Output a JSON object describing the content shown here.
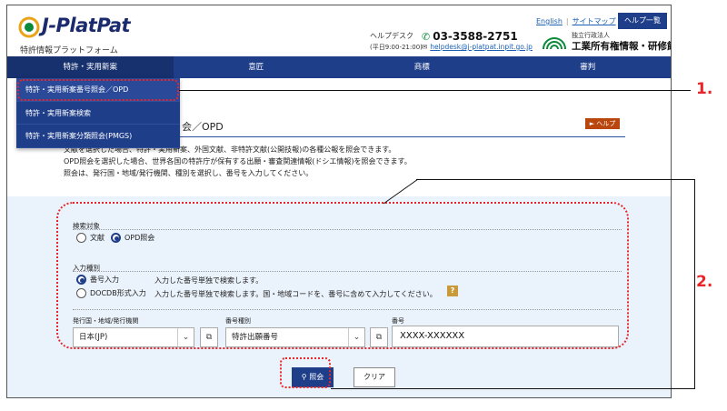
{
  "header": {
    "logo_text": "J-PlatPat",
    "logo_sub": "特許情報プラットフォーム",
    "helpdesk_label": "ヘルプデスク",
    "helpdesk_hours": "(平日9:00-21:00)",
    "phone": "03-3588-2751",
    "email": "helpdesk@j-platpat.inpit.go.jp",
    "links": {
      "english": "English",
      "sitemap": "サイトマップ"
    },
    "help_list": "ヘルプ一覧",
    "org_sub": "独立行政法人",
    "org_name": "工業所有権情報・研修館",
    "org_mark_text": "INPIT"
  },
  "nav": {
    "items": [
      "特許・実用新案",
      "意匠",
      "商標",
      "審判"
    ]
  },
  "dropdown": {
    "items": [
      "特許・実用新案番号照会／OPD",
      "特許・実用新案検索",
      "特許・実用新案分類照会(PMGS)"
    ]
  },
  "page": {
    "title": "会／OPD",
    "help": "► ヘルプ",
    "desc": [
      "文献を選択した場合、特許・実用新案、外国文献、非特許文献(公開技報)の各種公報を照会できます。",
      "OPD照会を選択した場合、世界各国の特許庁が保有する出願・審査関連情報(ドシエ情報)を照会できます。",
      "照会は、発行国・地域/発行機関、種別を選択し、番号を入力してください。"
    ]
  },
  "form": {
    "search_target_label": "検索対象",
    "target_options": [
      "文献",
      "OPD照会"
    ],
    "selected_target": "OPD照会",
    "input_type_label": "入力種別",
    "input_options": [
      {
        "label": "番号入力",
        "hint": "入力した番号単独で検索します。"
      },
      {
        "label": "DOCDB形式入力",
        "hint": "入力した番号単独で検索します。国・地域コードを、番号に含めて入力してください。"
      }
    ],
    "question_mark": "?",
    "country_label": "発行国・地域/発行機関",
    "country_value": "日本(JP)",
    "type_label": "番号種別",
    "type_value": "特許出願番号",
    "number_label": "番号",
    "number_value": "XXXX-XXXXXX",
    "search_button": "照会",
    "clear_button": "クリア"
  },
  "annotations": {
    "first": "1.",
    "second": "2."
  },
  "colors": {
    "nav": "#1f3e8a",
    "panel": "#eaf2fb",
    "annotation": "#e8262a",
    "help": "#b8460d"
  }
}
